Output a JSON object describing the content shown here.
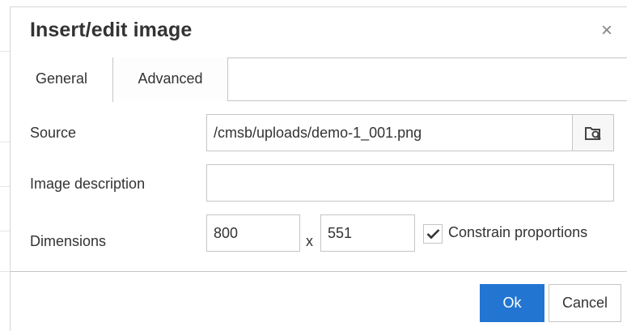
{
  "dialog": {
    "title": "Insert/edit image",
    "close_icon": "close-icon",
    "close_glyph": "×"
  },
  "tabs": [
    {
      "label": "General",
      "active": true
    },
    {
      "label": "Advanced",
      "active": false
    }
  ],
  "form": {
    "source": {
      "label": "Source",
      "value": "/cmsb/uploads/demo-1_001.png",
      "browse_icon": "folder-search-icon"
    },
    "description": {
      "label": "Image description",
      "value": ""
    },
    "dimensions": {
      "label": "Dimensions",
      "width": "800",
      "separator": "x",
      "height": "551",
      "constrain_label": "Constrain proportions",
      "constrain_checked": true
    }
  },
  "footer": {
    "ok_label": "Ok",
    "cancel_label": "Cancel"
  },
  "colors": {
    "primary": "#2276d2",
    "border": "#c5c5c5",
    "text": "#333333"
  }
}
